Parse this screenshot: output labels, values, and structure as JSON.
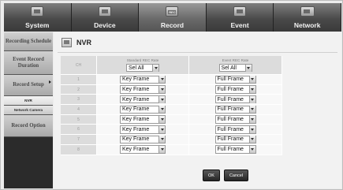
{
  "tabs": [
    {
      "label": "System",
      "icon": "system-icon"
    },
    {
      "label": "Device",
      "icon": "device-icon"
    },
    {
      "label": "Record",
      "icon": "record-icon"
    },
    {
      "label": "Event",
      "icon": "event-icon"
    },
    {
      "label": "Network",
      "icon": "network-icon"
    }
  ],
  "active_tab": "Record",
  "sidebar": {
    "items": [
      {
        "label": "Recording Schedule"
      },
      {
        "label": "Event Record Duration"
      },
      {
        "label": "Record Setup"
      },
      {
        "label": "NVR"
      },
      {
        "label": "Network Camera"
      },
      {
        "label": "Record Option"
      }
    ]
  },
  "panel": {
    "title": "NVR",
    "table": {
      "col_ch": "CH",
      "col_std": "Standard REC Rate",
      "col_evt": "Event REC Rate",
      "sel_all": "Sel All",
      "rows": [
        {
          "ch": "1",
          "std": "Key Frame",
          "evt": "Full Frame"
        },
        {
          "ch": "2",
          "std": "Key Frame",
          "evt": "Full Frame"
        },
        {
          "ch": "3",
          "std": "Key Frame",
          "evt": "Full Frame"
        },
        {
          "ch": "4",
          "std": "Key Frame",
          "evt": "Full Frame"
        },
        {
          "ch": "5",
          "std": "Key Frame",
          "evt": "Full Frame"
        },
        {
          "ch": "6",
          "std": "Key Frame",
          "evt": "Full Frame"
        },
        {
          "ch": "7",
          "std": "Key Frame",
          "evt": "Full Frame"
        },
        {
          "ch": "8",
          "std": "Key Frame",
          "evt": "Full Frame"
        }
      ]
    },
    "ok_label": "OK",
    "cancel_label": "Cancel"
  }
}
